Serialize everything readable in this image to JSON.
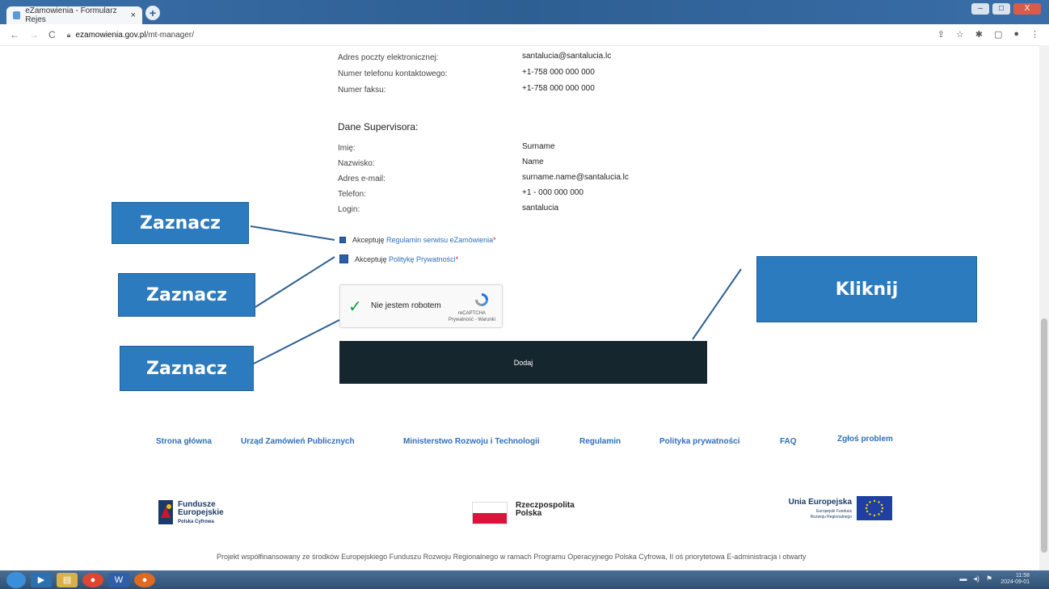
{
  "browser": {
    "tab_title": "eZamowienia - Formularz Rejes",
    "tab_close": "×",
    "new_tab": "+",
    "url_host": "ezamowienia.gov.pl",
    "url_path": "/mt-manager/",
    "win_min": "–",
    "win_max": "□",
    "win_close": "X"
  },
  "contact": {
    "rows": [
      {
        "label": "Adres poczty elektronicznej:",
        "value": "santalucia@santalucia.lc"
      },
      {
        "label": "Numer telefonu kontaktowego:",
        "value": "+1-758 000 000 000"
      },
      {
        "label": "Numer faksu:",
        "value": "+1-758 000 000 000"
      }
    ]
  },
  "supervisor": {
    "title": "Dane Supervisora:",
    "rows": [
      {
        "label": "Imię:",
        "value": "Surname"
      },
      {
        "label": "Nazwisko:",
        "value": "Name"
      },
      {
        "label": "Adres e-mail:",
        "value": "surname.name@santalucia.lc"
      },
      {
        "label": "Telefon:",
        "value": "+1 - 000 000 000"
      },
      {
        "label": "Login:",
        "value": "santalucia"
      }
    ]
  },
  "consents": {
    "terms_prefix": "Akceptuję",
    "terms_link": "Regulamin serwisu eZamówienia",
    "privacy_prefix": "Akceptuję",
    "privacy_link": "Politykę Prywatności",
    "required_mark": "*"
  },
  "recaptcha": {
    "label": "Nie jestem robotem",
    "brand": "reCAPTCHA",
    "links": "Prywatność - Warunki"
  },
  "submit_label": "Dodaj",
  "footer": {
    "links": [
      "Strona główna",
      "Urząd Zamówień Publicznych",
      "Ministerstwo Rozwoju i Technologii",
      "Regulamin",
      "Polityka prywatności",
      "FAQ",
      "Zgłoś problem"
    ],
    "fe_title_1": "Fundusze",
    "fe_title_2": "Europejskie",
    "fe_sub": "Polska Cyfrowa",
    "rp_title_1": "Rzeczpospolita",
    "rp_title_2": "Polska",
    "ue_title": "Unia Europejska",
    "ue_sub_1": "Europejski Fundusz",
    "ue_sub_2": "Rozwoju Regionalnego",
    "project_text": "Projekt współfinansowany ze środków Europejskiego Funduszu Rozwoju Regionalnego w ramach Programu Operacyjnego Polska Cyfrowa, II oś priorytetowa E-administracja i otwarty"
  },
  "annotations": {
    "check_label": "Zaznacz",
    "click_label": "Kliknij"
  },
  "taskbar": {
    "time": "11:58",
    "date": "2024-09-01"
  },
  "colors": {
    "accent": "#2d7bbf",
    "button_bg": "#16262e",
    "link": "#2f6fb7",
    "required": "#d0142c"
  }
}
